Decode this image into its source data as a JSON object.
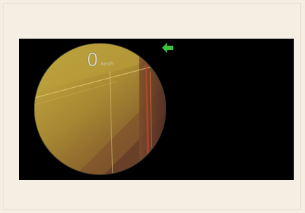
{
  "speedometer": {
    "value": "0",
    "unit": "km/h"
  },
  "direction_indicator": {
    "icon": "arrow-left-icon",
    "color": "#3cc23c"
  },
  "colors": {
    "page_background": "#f5eee3",
    "screen_background": "#000000"
  }
}
